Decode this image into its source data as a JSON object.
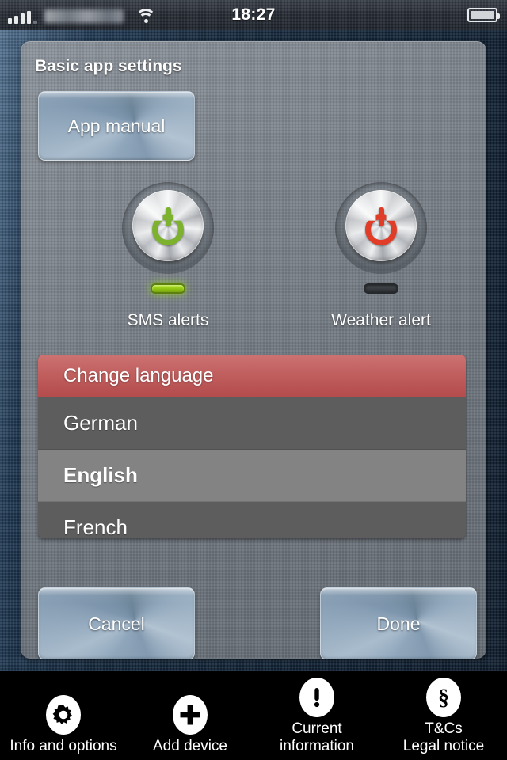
{
  "statusbar": {
    "time": "18:27",
    "carrier": "",
    "signal_icon": "signal-bars-icon",
    "wifi_icon": "wifi-icon",
    "battery_icon": "battery-icon"
  },
  "panel": {
    "title": "Basic app settings",
    "app_manual_label": "App manual",
    "cancel_label": "Cancel",
    "done_label": "Done"
  },
  "toggles": [
    {
      "id": "sms-alerts",
      "label": "SMS alerts",
      "state": "on",
      "icon": "power-icon",
      "color": "#7cb22e",
      "led_color": "#8fc412"
    },
    {
      "id": "weather-alert",
      "label": "Weather alert",
      "state": "off",
      "icon": "power-icon",
      "color": "#e03c28",
      "led_color": "#35383c"
    }
  ],
  "language_picker": {
    "header": "Change language",
    "header_color": "#c15f5f",
    "selected": "English",
    "options": [
      {
        "label": "German",
        "selected": false
      },
      {
        "label": "English",
        "selected": true
      },
      {
        "label": "French",
        "selected": false
      }
    ]
  },
  "tabbar": [
    {
      "icon": "gear-icon",
      "label_line1": "Info and options",
      "label_line2": ""
    },
    {
      "icon": "plus-icon",
      "label_line1": "Add device",
      "label_line2": ""
    },
    {
      "icon": "exclamation-icon",
      "label_line1": "Current",
      "label_line2": "information"
    },
    {
      "icon": "section-sign-icon",
      "label_line1": "T&Cs",
      "label_line2": "Legal notice"
    }
  ]
}
